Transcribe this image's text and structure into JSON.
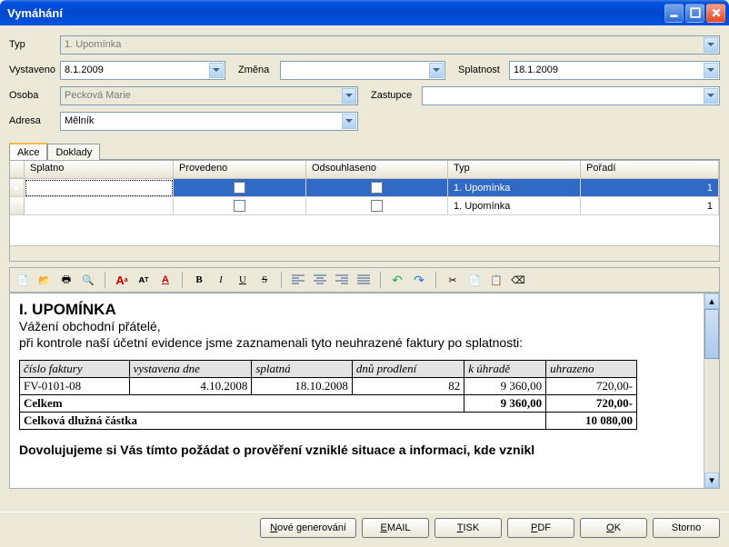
{
  "window": {
    "title": "Vymáhání"
  },
  "form": {
    "typ_label": "Typ",
    "typ_value": "1. Upomínka",
    "vystaveno_label": "Vystaveno",
    "vystaveno_value": "8.1.2009",
    "zmena_label": "Změna",
    "zmena_value": "",
    "splatnost_label": "Splatnost",
    "splatnost_value": "18.1.2009",
    "osoba_label": "Osoba",
    "osoba_value": "Pecková Marie",
    "zastupce_label": "Zastupce",
    "zastupce_value": "",
    "adresa_label": "Adresa",
    "adresa_value": "Mělník"
  },
  "tabs": {
    "akce": "Akce",
    "doklady": "Doklady"
  },
  "grid": {
    "headers": {
      "splatno": "Splatno",
      "provedeno": "Provedeno",
      "odsouhlaseno": "Odsouhlaseno",
      "typ": "Typ",
      "poradi": "Pořadí"
    },
    "rows": [
      {
        "splatno": "",
        "typ": "1. Upomínka",
        "poradi": "1"
      },
      {
        "splatno": "",
        "typ": "1. Upomínka",
        "poradi": "1"
      }
    ]
  },
  "editor": {
    "heading": "I. UPOMÍNKA",
    "line1": "Vážení obchodní přátelé,",
    "line2": "při kontrole naší účetní evidence jsme zaznamenali tyto neuhrazené faktury po splatnosti:",
    "footer_text": "Dovolujujeme si Vás tímto požádat o prověření vzniklé situace a informaci, kde vznikl",
    "invoice_table": {
      "headers": [
        "číslo faktury",
        "vystavena dne",
        "splatná",
        "dnů prodlení",
        "k úhradě",
        "uhrazeno"
      ],
      "rows": [
        [
          "FV-0101-08",
          "4.10.2008",
          "18.10.2008",
          "82",
          "9 360,00",
          "720,00-"
        ]
      ],
      "celkem_label": "Celkem",
      "celkem_k_uhrade": "9 360,00",
      "celkem_uhrazeno": "720,00-",
      "dluzna_label": "Celková dlužná částka",
      "dluzna_value": "10 080,00"
    }
  },
  "buttons": {
    "nove": "Nové generování",
    "email": "EMAIL",
    "tisk": "TISK",
    "pdf": "PDF",
    "ok": "OK",
    "storno": "Storno"
  },
  "icons": {
    "new": "📄",
    "open": "📂",
    "print": "🖨",
    "preview": "🔍",
    "fontsize_up": "A",
    "fontsize_down": "A",
    "fontcolor": "A",
    "bold": "B",
    "italic": "I",
    "underline": "U",
    "strike": "S",
    "align_l": "≡",
    "align_c": "≡",
    "align_r": "≡",
    "align_j": "≡",
    "undo": "↶",
    "redo": "↷",
    "cut": "✂",
    "copy": "📄",
    "paste": "📋",
    "erase": "⌫"
  }
}
